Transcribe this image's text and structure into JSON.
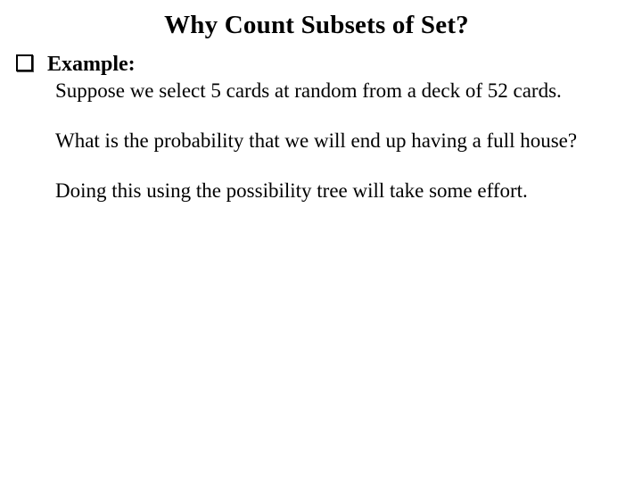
{
  "title": "Why Count Subsets of Set?",
  "bullet_label": "Example:",
  "paragraphs": {
    "p1": "Suppose we select 5 cards at random from a deck of 52 cards.",
    "p2": "What is the probability that we will end up having a full house?",
    "p3": "Doing this using the possibility tree will take some effort."
  }
}
